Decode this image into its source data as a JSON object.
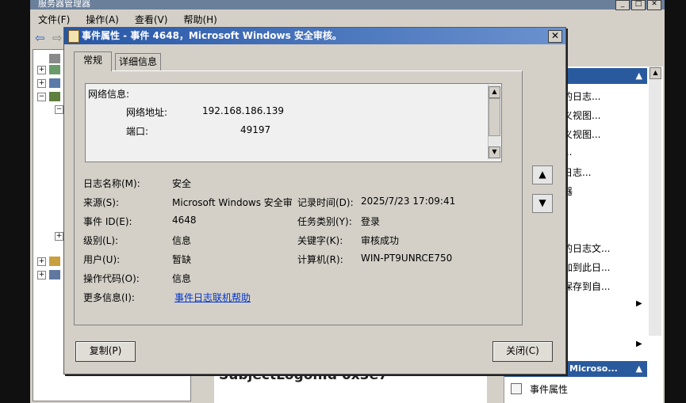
{
  "background_window": {
    "title": "服务器管理器",
    "menu": [
      "文件(F)",
      "操作(A)",
      "查看(V)",
      "帮助(H)"
    ],
    "actions": {
      "items": [
        "的日志...",
        "义视图...",
        "义视图...",
        "...",
        "日志...",
        "器",
        "的日志文...",
        "加到此日...",
        "保存到自...",
        "事件属性"
      ],
      "section_header": "Microso..."
    },
    "center_text": "SubjectLogonId 0x3e7"
  },
  "dialog": {
    "title": "事件属性 - 事件 4648，Microsoft Windows 安全审核。",
    "close_label": "✕",
    "tabs": [
      "常规",
      "详细信息"
    ],
    "description": {
      "heading": "网络信息:",
      "address_label": "网络地址:",
      "address_value": "192.168.186.139",
      "port_label": "端口:",
      "port_value": "49197"
    },
    "fields": {
      "log_name_label": "日志名称(M):",
      "log_name_value": "安全",
      "source_label": "来源(S):",
      "source_value": "Microsoft Windows 安全审",
      "logged_label": "记录时间(D):",
      "logged_value": "2025/7/23 17:09:41",
      "event_id_label": "事件 ID(E):",
      "event_id_value": "4648",
      "task_label": "任务类别(Y):",
      "task_value": "登录",
      "level_label": "级别(L):",
      "level_value": "信息",
      "keywords_label": "关键字(K):",
      "keywords_value": "审核成功",
      "user_label": "用户(U):",
      "user_value": "暂缺",
      "computer_label": "计算机(R):",
      "computer_value": "WIN-PT9UNRCE750",
      "opcode_label": "操作代码(O):",
      "opcode_value": "信息",
      "more_info_label": "更多信息(I):",
      "more_info_link": "事件日志联机帮助"
    },
    "copy_button": "复制(P)",
    "close_button": "关闭(C)"
  }
}
